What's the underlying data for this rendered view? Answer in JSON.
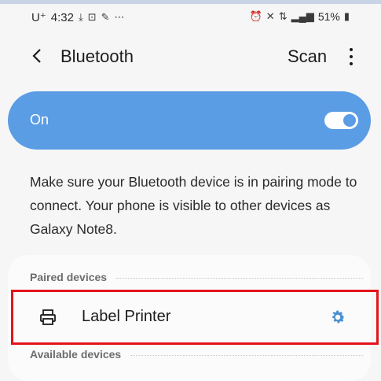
{
  "status_bar": {
    "carrier": "U⁺",
    "time": "4:32",
    "left_icons": [
      "download-icon",
      "lock-icon",
      "pen-icon",
      "more-notifications-icon"
    ],
    "right_icons": [
      "alarm-icon",
      "mute-icon",
      "lte-icon",
      "signal-icon"
    ],
    "battery": "51%"
  },
  "header": {
    "title": "Bluetooth",
    "scan_label": "Scan",
    "more_icon": "more-vertical-icon",
    "back_icon": "back-chevron-icon"
  },
  "bluetooth_toggle": {
    "label": "On",
    "state": true,
    "accent": "#5b9de4"
  },
  "description": "Make sure your Bluetooth device is in pairing mode to connect. Your phone is visible to other devices as Galaxy Note8.",
  "paired_section": {
    "header": "Paired devices",
    "devices": [
      {
        "name": "Label Printer",
        "icon": "printer-icon",
        "settings_icon": "gear-icon"
      }
    ]
  },
  "available_section": {
    "header": "Available devices"
  },
  "highlight_color": "#e3141b"
}
